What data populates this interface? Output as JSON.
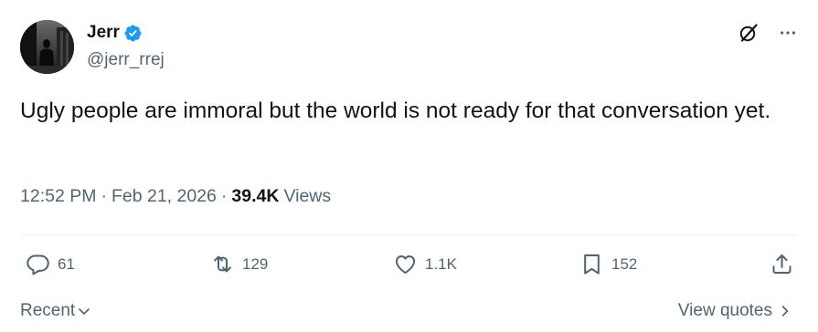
{
  "author": {
    "display_name": "Jerr",
    "handle": "@jerr_rrej",
    "verified_icon": "verified-badge-icon",
    "avatar_icon": "profile-photo"
  },
  "header_actions": {
    "grok_icon": "grok-slash-icon",
    "more_icon": "more-dots-icon"
  },
  "tweet": {
    "text": "Ugly people are immoral but the world is not ready for that conversation yet."
  },
  "meta": {
    "time": "12:52 PM",
    "separator": "·",
    "date": "Feb 21, 2026",
    "views_count": "39.4K",
    "views_label": "Views"
  },
  "actions": {
    "reply_count": "61",
    "retweet_count": "129",
    "like_count": "1.1K",
    "bookmark_count": "152",
    "share_icon": "share-icon"
  },
  "footer": {
    "sort_label": "Recent",
    "view_quotes_label": "View quotes"
  },
  "colors": {
    "text_primary": "#0f1419",
    "text_secondary": "#536471",
    "verified_blue": "#1d9bf0",
    "divider": "#eff3f4"
  }
}
